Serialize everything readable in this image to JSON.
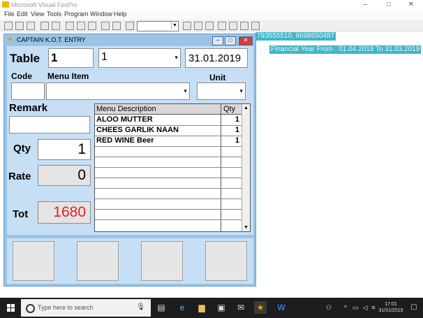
{
  "app": {
    "title": "Microsoft Visual FoxPro"
  },
  "menu": [
    "File",
    "Edit",
    "View",
    "Tools",
    "Program",
    "Window",
    "Help"
  ],
  "info": {
    "phone": "793555510, 8698650487",
    "financial_year": "Financial Year From : 01.04.2018 To 31.03.2019"
  },
  "dialog": {
    "title": "CAPTAIN K.O.T. ENTRY",
    "table_label": "Table",
    "table_value": "1",
    "table_select_value": "1",
    "date": "31.01.2019",
    "code_label": "Code",
    "menu_item_label": "Menu Item",
    "unit_label": "Unit",
    "remark_label": "Remark",
    "qty_label": "Qty",
    "qty_value": "1",
    "rate_label": "Rate",
    "rate_value": "0",
    "tot_label": "Tot",
    "tot_value": "1680",
    "grid": {
      "headers": [
        "Menu Description",
        "Qty"
      ],
      "rows": [
        {
          "desc": "ALOO MUTTER",
          "qty": "1"
        },
        {
          "desc": "CHEES GARLIK NAAN",
          "qty": "1"
        },
        {
          "desc": "RED WINE Beer",
          "qty": "1"
        }
      ]
    }
  },
  "taskbar": {
    "search_placeholder": "Type here to search",
    "time": "17:01",
    "date": "31/01/2019"
  },
  "colors": {
    "dialog_bg": "#99c4e8",
    "form_bg": "#c7dff5",
    "total_text": "#e02020",
    "info_bg": "#3fb6c6"
  },
  "icons": [
    "fox-icon",
    "search-icon",
    "microphone-icon",
    "task-view-icon",
    "edge-icon",
    "folder-icon",
    "store-icon",
    "mail-icon",
    "word-icon"
  ]
}
